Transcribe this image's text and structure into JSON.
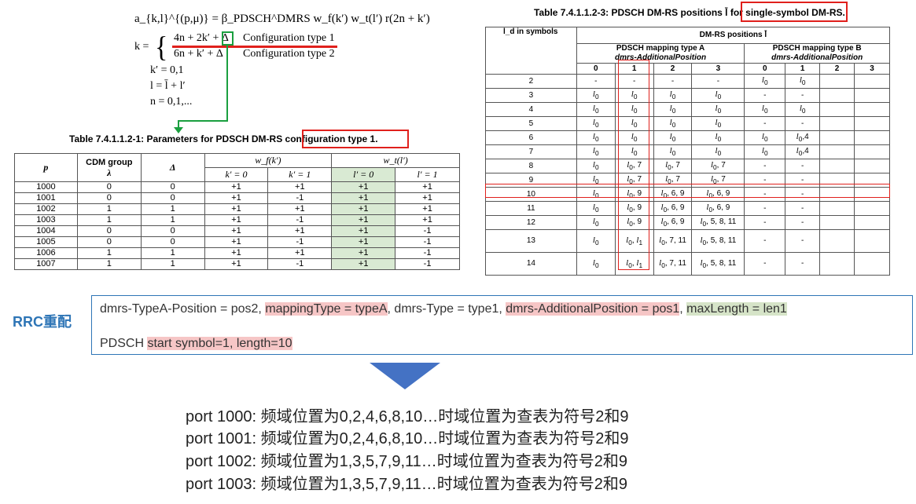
{
  "formula": {
    "line1": "a_{k,l}^{(p,μ)} = β_PDSCH^DMRS w_f(k′) w_t(l′) r(2n + k′)",
    "k_label": "k =",
    "case1_expr": "4n + 2k′ + Δ",
    "case1_label": "Configuration type 1",
    "case2_expr": "6n + k′ + Δ",
    "case2_label": "Configuration type 2",
    "kprime": "k′ = 0,1",
    "l_def": "l = l̄ + l′",
    "n_def": "n = 0,1,..."
  },
  "table1": {
    "caption_prefix": "Table 7.4.1.1.2-1: Parameters for PDSCH DM-RS ",
    "caption_highlight": "configuration type 1.",
    "headers": {
      "p": "p",
      "cdm_line1": "CDM group",
      "cdm_line2": "λ",
      "delta": "Δ",
      "wf": "w_f(k′)",
      "wt": "w_t(l′)",
      "k0": "k′ = 0",
      "k1": "k′ = 1",
      "l0": "l′ = 0",
      "l1": "l′ = 1"
    },
    "rows": [
      [
        "1000",
        "0",
        "0",
        "+1",
        "+1",
        "+1",
        "+1"
      ],
      [
        "1001",
        "0",
        "0",
        "+1",
        "-1",
        "+1",
        "+1"
      ],
      [
        "1002",
        "1",
        "1",
        "+1",
        "+1",
        "+1",
        "+1"
      ],
      [
        "1003",
        "1",
        "1",
        "+1",
        "-1",
        "+1",
        "+1"
      ],
      [
        "1004",
        "0",
        "0",
        "+1",
        "+1",
        "+1",
        "-1"
      ],
      [
        "1005",
        "0",
        "0",
        "+1",
        "-1",
        "+1",
        "-1"
      ],
      [
        "1006",
        "1",
        "1",
        "+1",
        "+1",
        "+1",
        "-1"
      ],
      [
        "1007",
        "1",
        "1",
        "+1",
        "-1",
        "+1",
        "-1"
      ]
    ]
  },
  "table3": {
    "caption_prefix": "Table 7.4.1.1.2-3: PDSCH DM-RS positions l̄  for ",
    "caption_highlight": "single-symbol DM-RS.",
    "ld_header": "l_d in symbols",
    "positions_header": "DM-RS positions l̄",
    "type_a": "PDSCH mapping type A",
    "type_b": "PDSCH mapping type B",
    "add_pos": "dmrs-AdditionalPosition",
    "cols": [
      "0",
      "1",
      "2",
      "3",
      "0",
      "1",
      "2",
      "3"
    ],
    "rows": [
      [
        "2",
        "-",
        "-",
        "-",
        "-",
        "l0",
        "l0",
        "",
        ""
      ],
      [
        "3",
        "l0",
        "l0",
        "l0",
        "l0",
        "-",
        "-",
        "",
        ""
      ],
      [
        "4",
        "l0",
        "l0",
        "l0",
        "l0",
        "l0",
        "l0",
        "",
        ""
      ],
      [
        "5",
        "l0",
        "l0",
        "l0",
        "l0",
        "-",
        "-",
        "",
        ""
      ],
      [
        "6",
        "l0",
        "l0",
        "l0",
        "l0",
        "l0",
        "l0,4",
        "",
        ""
      ],
      [
        "7",
        "l0",
        "l0",
        "l0",
        "l0",
        "l0",
        "l0,4",
        "",
        ""
      ],
      [
        "8",
        "l0",
        "l0, 7",
        "l0, 7",
        "l0, 7",
        "-",
        "-",
        "",
        ""
      ],
      [
        "9",
        "l0",
        "l0, 7",
        "l0, 7",
        "l0, 7",
        "-",
        "-",
        "",
        ""
      ],
      [
        "10",
        "l0",
        "l0, 9",
        "l0, 6, 9",
        "l0, 6, 9",
        "-",
        "-",
        "",
        ""
      ],
      [
        "11",
        "l0",
        "l0, 9",
        "l0, 6, 9",
        "l0, 6, 9",
        "-",
        "-",
        "",
        ""
      ],
      [
        "12",
        "l0",
        "l0, 9",
        "l0, 6, 9",
        "l0, 5, 8, 11",
        "-",
        "-",
        "",
        ""
      ],
      [
        "13",
        "l0",
        "l0, l1",
        "l0, 7, 11",
        "l0, 5, 8, 11",
        "-",
        "-",
        "",
        ""
      ],
      [
        "14",
        "l0",
        "l0, l1",
        "l0, 7, 11",
        "l0, 5, 8, 11",
        "-",
        "-",
        "",
        ""
      ]
    ]
  },
  "rrc": {
    "label": "RRC重配",
    "line1_a": "dmrs-TypeA-Position = pos2, ",
    "line1_b": "mappingType = typeA",
    "line1_c": ", dmrs-Type = type1, ",
    "line1_d": " dmrs-AdditionalPosition = pos1",
    "line1_e": ", ",
    "line1_f": "maxLength = len1 ",
    "line2_a": "PDSCH ",
    "line2_b": "start symbol=1, length=10"
  },
  "ports": [
    "port 1000: 频域位置为0,2,4,6,8,10…时域位置为查表为符号2和9",
    "port 1001: 频域位置为0,2,4,6,8,10…时域位置为查表为符号2和9",
    "port 1002: 频域位置为1,3,5,7,9,11…时域位置为查表为符号2和9",
    "port 1003: 频域位置为1,3,5,7,9,11…时域位置为查表为符号2和9"
  ],
  "colors": {
    "red": "#e0201c",
    "green": "#1a9f3f",
    "blue": "#2e75b6",
    "pink": "#f6c6c6",
    "lightgreen": "#d6e4c8"
  }
}
